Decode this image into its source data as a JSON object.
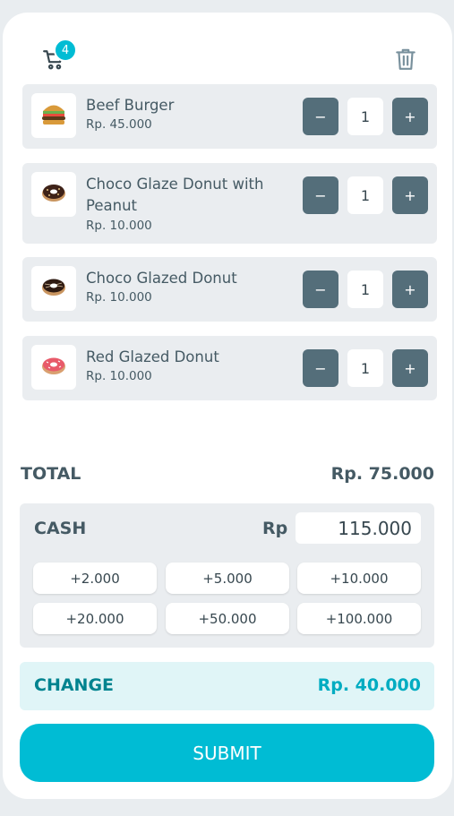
{
  "cart": {
    "count": "4",
    "icon": "cart-icon",
    "badge_color": "#00bcd4"
  },
  "trash": {
    "icon": "trash-icon"
  },
  "items": [
    {
      "name": "Beef Burger",
      "price": "Rp. 45.000",
      "qty": "1",
      "minus": "−",
      "plus": "+",
      "icon": "burger-icon"
    },
    {
      "name": "Choco Glaze Donut with Peanut",
      "price": "Rp. 10.000",
      "qty": "1",
      "minus": "−",
      "plus": "+",
      "icon": "donut-icon"
    },
    {
      "name": "Choco Glazed Donut",
      "price": "Rp. 10.000",
      "qty": "1",
      "minus": "−",
      "plus": "+",
      "icon": "donut-icon"
    },
    {
      "name": "Red Glazed Donut",
      "price": "Rp. 10.000",
      "qty": "1",
      "minus": "−",
      "plus": "+",
      "icon": "donut-icon"
    }
  ],
  "total": {
    "label": "TOTAL",
    "value": "Rp. 75.000"
  },
  "cash": {
    "label": "CASH",
    "currency": "Rp",
    "value": "115.000",
    "quick": [
      "+2.000",
      "+5.000",
      "+10.000",
      "+20.000",
      "+50.000",
      "+100.000"
    ]
  },
  "change": {
    "label": "CHANGE",
    "value": "Rp. 40.000"
  },
  "submit_label": "SUBMIT",
  "colors": {
    "accent": "#00bcd4",
    "stepper": "#546e7a",
    "panel": "#eaedf0",
    "change_bg": "#e0f5f7"
  }
}
